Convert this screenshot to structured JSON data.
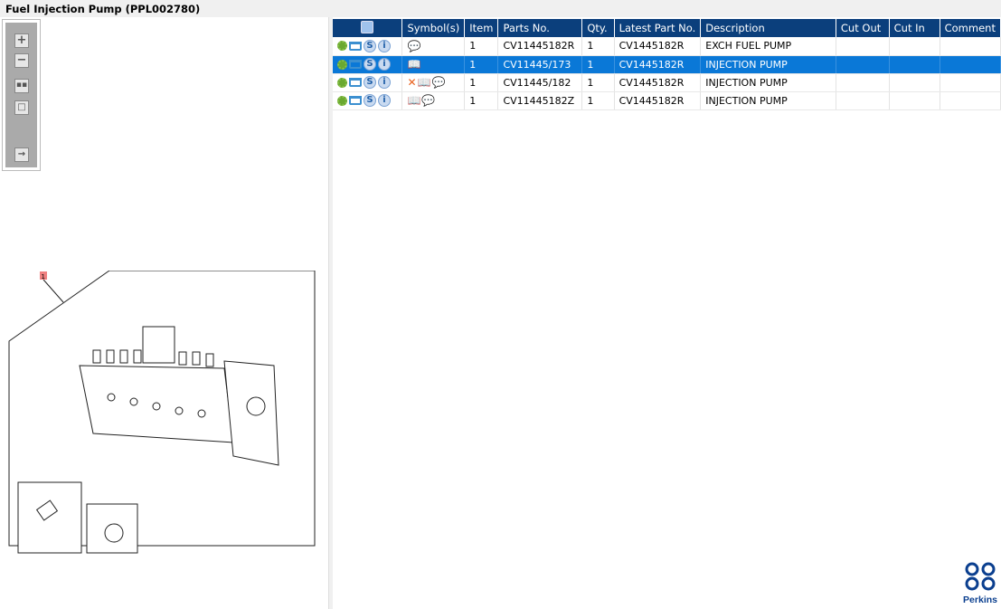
{
  "title": "Fuel Injection Pump (PPL002780)",
  "toolbar": {
    "items": [
      "zoom-in",
      "zoom-out",
      "fit-all",
      "fit-window",
      "export"
    ]
  },
  "drawing": {
    "callout": "1"
  },
  "table": {
    "columns": [
      "",
      "Symbol(s)",
      "Item",
      "Parts No.",
      "Qty.",
      "Latest Part No.",
      "Description",
      "Cut Out",
      "Cut In",
      "Comment"
    ],
    "rows": [
      {
        "symbols": [
          "comment"
        ],
        "item": "1",
        "part": "CV11445182R",
        "qty": "1",
        "latest": "CV1445182R",
        "desc": "EXCH FUEL PUMP",
        "cut_out": "",
        "cut_in": "",
        "comment": "",
        "selected": false
      },
      {
        "symbols": [
          "book"
        ],
        "item": "1",
        "part": "CV11445/173",
        "qty": "1",
        "latest": "CV1445182R",
        "desc": "INJECTION PUMP",
        "cut_out": "",
        "cut_in": "",
        "comment": "",
        "selected": true
      },
      {
        "symbols": [
          "cross",
          "book",
          "comment"
        ],
        "item": "1",
        "part": "CV11445/182",
        "qty": "1",
        "latest": "CV1445182R",
        "desc": "INJECTION PUMP",
        "cut_out": "",
        "cut_in": "",
        "comment": "",
        "selected": false
      },
      {
        "symbols": [
          "book",
          "comment"
        ],
        "item": "1",
        "part": "CV11445182Z",
        "qty": "1",
        "latest": "CV1445182R",
        "desc": "INJECTION PUMP",
        "cut_out": "",
        "cut_in": "",
        "comment": "",
        "selected": false
      }
    ]
  },
  "row_icons": {
    "s": "S",
    "i": "i"
  },
  "logo": "Perkins",
  "colors": {
    "header": "#0b3f7c",
    "selected": "#0a78d7"
  }
}
